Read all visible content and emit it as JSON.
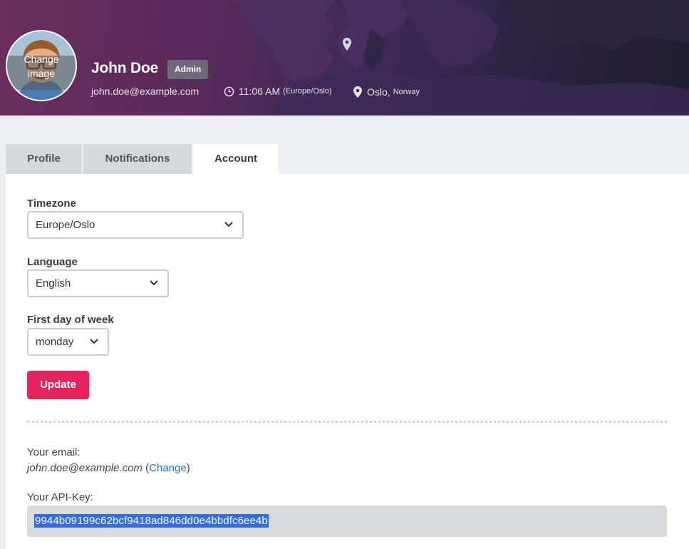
{
  "header": {
    "avatar_overlay": "Change image",
    "name": "John Doe",
    "role_badge": "Admin",
    "email": "john.doe@example.com",
    "time": "11:06 AM",
    "time_zone": "(Europe/Oslo)",
    "city": "Oslo,",
    "country": "Norway",
    "icons": {
      "clock": "clock-icon",
      "location": "map-pin-icon"
    }
  },
  "tabs": [
    {
      "label": "Profile",
      "active": false
    },
    {
      "label": "Notifications",
      "active": false
    },
    {
      "label": "Account",
      "active": true
    }
  ],
  "account": {
    "timezone": {
      "label": "Timezone",
      "value": "Europe/Oslo"
    },
    "language": {
      "label": "Language",
      "value": "English"
    },
    "first_day": {
      "label": "First day of week",
      "value": "monday"
    },
    "update_button": "Update",
    "email_label": "Your email:",
    "email_value": "john.doe@example.com",
    "email_change_link": "Change",
    "api_key_label": "Your API-Key:",
    "api_key_value": "9944b09199c62bcf9418ad846dd0e4bbdfc6ee4b"
  },
  "colors": {
    "accent": "#e5235f",
    "link": "#2a6fc9",
    "selection": "#2f6fe0"
  }
}
